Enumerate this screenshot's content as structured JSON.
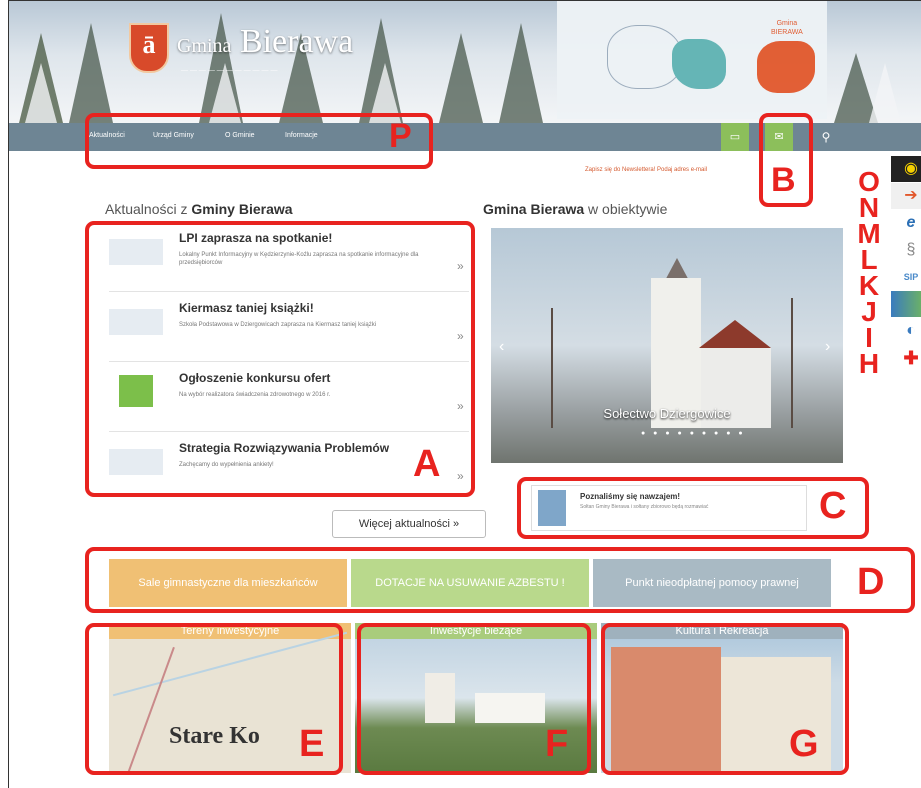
{
  "header": {
    "brand_prefix": "Gmina",
    "brand_name": "Bierawa",
    "map_label": "Gmina\nBIERAWA"
  },
  "nav": {
    "items": [
      "Aktualności",
      "Urząd Gminy",
      "O Gminie",
      "Informacje"
    ],
    "newsletter": "Zapisz się do Newslettera! Podaj adres e-mail"
  },
  "news_section": {
    "heading_prefix": "Aktualności z",
    "heading_bold": "Gminy Bierawa",
    "items": [
      {
        "title": "LPI zaprasza na spotkanie!",
        "excerpt": "Lokalny Punkt Informacyjny w Kędzierzynie-Koźlu zaprasza na spotkanie informacyjne dla przedsiębiorców"
      },
      {
        "title": "Kiermasz taniej książki!",
        "excerpt": "Szkoła Podstawowa w Dziergowicach zaprasza na Kiermasz taniej książki"
      },
      {
        "title": "Ogłoszenie konkursu ofert",
        "excerpt": "Na wybór realizatora świadczenia zdrowotnego w 2016 r."
      },
      {
        "title": "Strategia Rozwiązywania Problemów",
        "excerpt": "Zachęcamy do wypełnienia ankiety!"
      }
    ],
    "more_button": "Więcej aktualności »"
  },
  "gallery": {
    "heading_bold": "Gmina Bierawa",
    "heading_suffix": "w obiektywie",
    "caption": "Sołectwo Dziergowice"
  },
  "promo": {
    "title": "Poznaliśmy się nawzajem!",
    "excerpt": "Sołtan Gminy Bierawa i sołtany zbiorowo będą rozmawiać"
  },
  "banners": [
    {
      "label": "Sale gimnastyczne dla mieszkańców",
      "color": "#f0c074"
    },
    {
      "label": "DOTACJE NA USUWANIE AZBESTU !",
      "color": "#b9d98c"
    },
    {
      "label": "Punkt nieodpłatnej pomocy prawnej",
      "color": "#a9bac4"
    }
  ],
  "tiles": [
    {
      "label": "Tereny inwestycyjne",
      "color": "#f0c074",
      "map_text": "Stare Ko"
    },
    {
      "label": "Inwestycje bieżące",
      "color": "#a9cc7c"
    },
    {
      "label": "Kultura i Rekreacja",
      "color": "#9fb1bd"
    }
  ],
  "annotations": {
    "P": "P",
    "B": "B",
    "A": "A",
    "C": "C",
    "D": "D",
    "E": "E",
    "F": "F",
    "G": "G",
    "side": [
      "O",
      "N",
      "M",
      "L",
      "K",
      "J",
      "I",
      "H"
    ]
  },
  "colors": {
    "accent_green": "#8cbf5b",
    "nav_bg": "#6e8594",
    "annotation_red": "#e8231f"
  },
  "icons": {
    "nav_buttons": [
      "monitor-icon",
      "mail-icon",
      "search-icon"
    ],
    "side": [
      "eye-icon",
      "arrow-icon",
      "e-icon",
      "paragraph-icon",
      "sip-icon",
      "bar-icon",
      "person-icon",
      "cross-icon"
    ]
  }
}
